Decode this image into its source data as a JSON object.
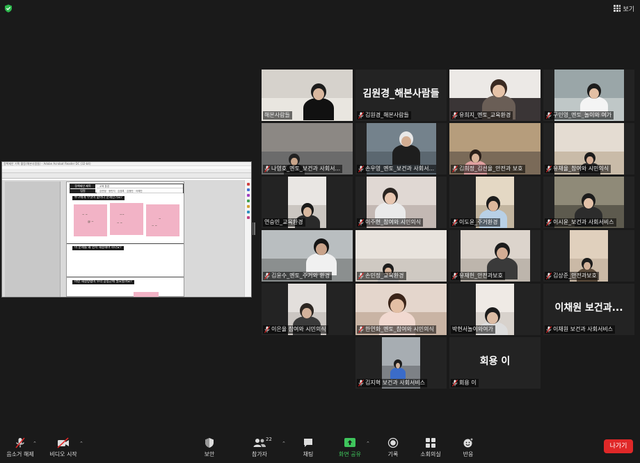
{
  "header": {
    "view_label": "보기",
    "icons": [
      "shield-check-icon",
      "grid-icon"
    ],
    "accent_color": "#2db84d"
  },
  "share_screen": {
    "window_title": "정책제안 기획 활동(해본사람들) - Adobe Acrobat Reader DC (32-bit)",
    "doc": {
      "header_title_label": "정책제안 제목",
      "header_title_value": "교육 환경",
      "header_team_label": "팀원",
      "header_team_value": "김연정 · 정민지 · 김경록 · 김정민 · 이예진",
      "question1": "누구에게 무엇이 없어나 문제인가요?",
      "question2": "이 문제를 왜 먼저 해결해야 하나요?",
      "question3": "어떤 해결방법이 우리 공동군에 필요할까요?"
    }
  },
  "gallery": [
    {
      "name": "해본사람들",
      "big": "",
      "muted": false,
      "active": true
    },
    {
      "name": "김원경_해본사람들",
      "big": "김원경_해본사람들",
      "muted": true,
      "active": false
    },
    {
      "name": "유희지_멘토_교육환경",
      "big": "",
      "muted": true,
      "active": false
    },
    {
      "name": "구민영_멘토_놀이와 여가",
      "big": "",
      "muted": true,
      "active": false
    },
    {
      "name": "나영호_멘토_보건과 사회서...",
      "big": "",
      "muted": true,
      "active": false
    },
    {
      "name": "손우영_멘토_보건과 사회서...",
      "big": "",
      "muted": true,
      "active": false
    },
    {
      "name": "김희정_김선율_안전과 보호",
      "big": "",
      "muted": true,
      "active": false
    },
    {
      "name": "유채율_참여와 시민의식",
      "big": "",
      "muted": true,
      "active": false
    },
    {
      "name": "연승민_교육환경",
      "big": "",
      "muted": false,
      "active": false
    },
    {
      "name": "이주현_참여와 시민의식",
      "big": "",
      "muted": true,
      "active": false
    },
    {
      "name": "이도윤_주거환경",
      "big": "",
      "muted": true,
      "active": false
    },
    {
      "name": "이시윤_보건과 사회서비스",
      "big": "",
      "muted": true,
      "active": false
    },
    {
      "name": "김윤수_멘토_주거와 환경",
      "big": "",
      "muted": true,
      "active": false
    },
    {
      "name": "손민정_교육환경",
      "big": "",
      "muted": true,
      "active": false
    },
    {
      "name": "유재헌_안전과보호",
      "big": "",
      "muted": true,
      "active": false
    },
    {
      "name": "김상준_안전과보호",
      "big": "",
      "muted": true,
      "active": false
    },
    {
      "name": "이은율 참여와 시민의식",
      "big": "",
      "muted": true,
      "active": false
    },
    {
      "name": "한연화_멘토_참여와 시민의식",
      "big": "",
      "muted": true,
      "active": false
    },
    {
      "name": "박현서놀이와여가",
      "big": "",
      "muted": false,
      "active": false
    },
    {
      "name": "이채원 보건과 사회서비스",
      "big": "이채원 보건과...",
      "muted": true,
      "active": false
    },
    {
      "name": "김지혁 보건과 사회서비스",
      "big": "",
      "muted": true,
      "active": false
    },
    {
      "name": "회용 이",
      "big": "회용 이",
      "muted": true,
      "active": false
    }
  ],
  "toolbar": {
    "unmute_label": "음소거 해제",
    "video_label": "비디오 시작",
    "security_label": "보안",
    "participants_label": "참가자",
    "participants_count": "22",
    "chat_label": "채팅",
    "share_label": "화면 공유",
    "record_label": "기록",
    "breakout_label": "소회의실",
    "reactions_label": "반응",
    "leave_label": "나가기",
    "leave_color": "#e02828",
    "share_color": "#3fc55c"
  }
}
